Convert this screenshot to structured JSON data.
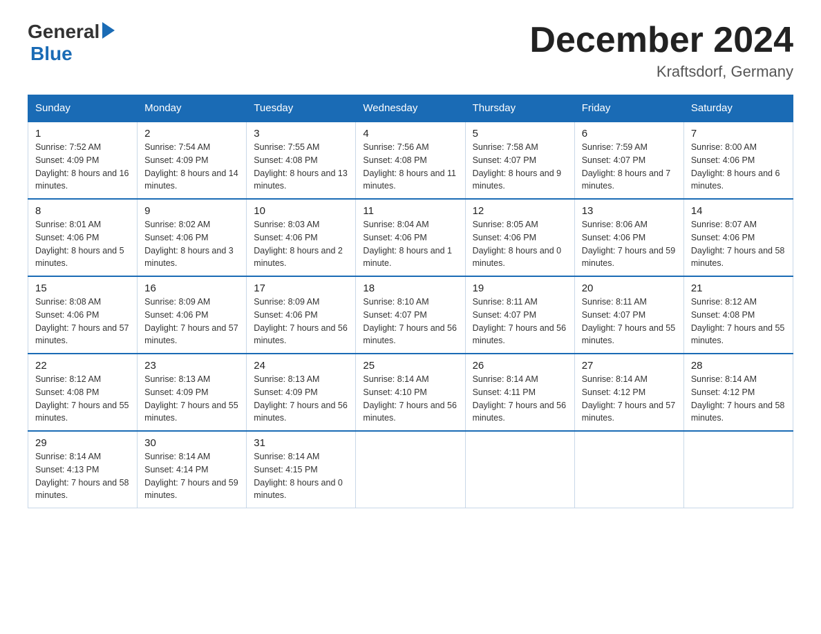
{
  "logo": {
    "general": "General",
    "blue": "Blue"
  },
  "title": "December 2024",
  "subtitle": "Kraftsdorf, Germany",
  "days_of_week": [
    "Sunday",
    "Monday",
    "Tuesday",
    "Wednesday",
    "Thursday",
    "Friday",
    "Saturday"
  ],
  "weeks": [
    [
      {
        "day": "1",
        "sunrise": "7:52 AM",
        "sunset": "4:09 PM",
        "daylight": "8 hours and 16 minutes."
      },
      {
        "day": "2",
        "sunrise": "7:54 AM",
        "sunset": "4:09 PM",
        "daylight": "8 hours and 14 minutes."
      },
      {
        "day": "3",
        "sunrise": "7:55 AM",
        "sunset": "4:08 PM",
        "daylight": "8 hours and 13 minutes."
      },
      {
        "day": "4",
        "sunrise": "7:56 AM",
        "sunset": "4:08 PM",
        "daylight": "8 hours and 11 minutes."
      },
      {
        "day": "5",
        "sunrise": "7:58 AM",
        "sunset": "4:07 PM",
        "daylight": "8 hours and 9 minutes."
      },
      {
        "day": "6",
        "sunrise": "7:59 AM",
        "sunset": "4:07 PM",
        "daylight": "8 hours and 7 minutes."
      },
      {
        "day": "7",
        "sunrise": "8:00 AM",
        "sunset": "4:06 PM",
        "daylight": "8 hours and 6 minutes."
      }
    ],
    [
      {
        "day": "8",
        "sunrise": "8:01 AM",
        "sunset": "4:06 PM",
        "daylight": "8 hours and 5 minutes."
      },
      {
        "day": "9",
        "sunrise": "8:02 AM",
        "sunset": "4:06 PM",
        "daylight": "8 hours and 3 minutes."
      },
      {
        "day": "10",
        "sunrise": "8:03 AM",
        "sunset": "4:06 PM",
        "daylight": "8 hours and 2 minutes."
      },
      {
        "day": "11",
        "sunrise": "8:04 AM",
        "sunset": "4:06 PM",
        "daylight": "8 hours and 1 minute."
      },
      {
        "day": "12",
        "sunrise": "8:05 AM",
        "sunset": "4:06 PM",
        "daylight": "8 hours and 0 minutes."
      },
      {
        "day": "13",
        "sunrise": "8:06 AM",
        "sunset": "4:06 PM",
        "daylight": "7 hours and 59 minutes."
      },
      {
        "day": "14",
        "sunrise": "8:07 AM",
        "sunset": "4:06 PM",
        "daylight": "7 hours and 58 minutes."
      }
    ],
    [
      {
        "day": "15",
        "sunrise": "8:08 AM",
        "sunset": "4:06 PM",
        "daylight": "7 hours and 57 minutes."
      },
      {
        "day": "16",
        "sunrise": "8:09 AM",
        "sunset": "4:06 PM",
        "daylight": "7 hours and 57 minutes."
      },
      {
        "day": "17",
        "sunrise": "8:09 AM",
        "sunset": "4:06 PM",
        "daylight": "7 hours and 56 minutes."
      },
      {
        "day": "18",
        "sunrise": "8:10 AM",
        "sunset": "4:07 PM",
        "daylight": "7 hours and 56 minutes."
      },
      {
        "day": "19",
        "sunrise": "8:11 AM",
        "sunset": "4:07 PM",
        "daylight": "7 hours and 56 minutes."
      },
      {
        "day": "20",
        "sunrise": "8:11 AM",
        "sunset": "4:07 PM",
        "daylight": "7 hours and 55 minutes."
      },
      {
        "day": "21",
        "sunrise": "8:12 AM",
        "sunset": "4:08 PM",
        "daylight": "7 hours and 55 minutes."
      }
    ],
    [
      {
        "day": "22",
        "sunrise": "8:12 AM",
        "sunset": "4:08 PM",
        "daylight": "7 hours and 55 minutes."
      },
      {
        "day": "23",
        "sunrise": "8:13 AM",
        "sunset": "4:09 PM",
        "daylight": "7 hours and 55 minutes."
      },
      {
        "day": "24",
        "sunrise": "8:13 AM",
        "sunset": "4:09 PM",
        "daylight": "7 hours and 56 minutes."
      },
      {
        "day": "25",
        "sunrise": "8:14 AM",
        "sunset": "4:10 PM",
        "daylight": "7 hours and 56 minutes."
      },
      {
        "day": "26",
        "sunrise": "8:14 AM",
        "sunset": "4:11 PM",
        "daylight": "7 hours and 56 minutes."
      },
      {
        "day": "27",
        "sunrise": "8:14 AM",
        "sunset": "4:12 PM",
        "daylight": "7 hours and 57 minutes."
      },
      {
        "day": "28",
        "sunrise": "8:14 AM",
        "sunset": "4:12 PM",
        "daylight": "7 hours and 58 minutes."
      }
    ],
    [
      {
        "day": "29",
        "sunrise": "8:14 AM",
        "sunset": "4:13 PM",
        "daylight": "7 hours and 58 minutes."
      },
      {
        "day": "30",
        "sunrise": "8:14 AM",
        "sunset": "4:14 PM",
        "daylight": "7 hours and 59 minutes."
      },
      {
        "day": "31",
        "sunrise": "8:14 AM",
        "sunset": "4:15 PM",
        "daylight": "8 hours and 0 minutes."
      },
      null,
      null,
      null,
      null
    ]
  ],
  "labels": {
    "sunrise": "Sunrise:",
    "sunset": "Sunset:",
    "daylight": "Daylight:"
  }
}
